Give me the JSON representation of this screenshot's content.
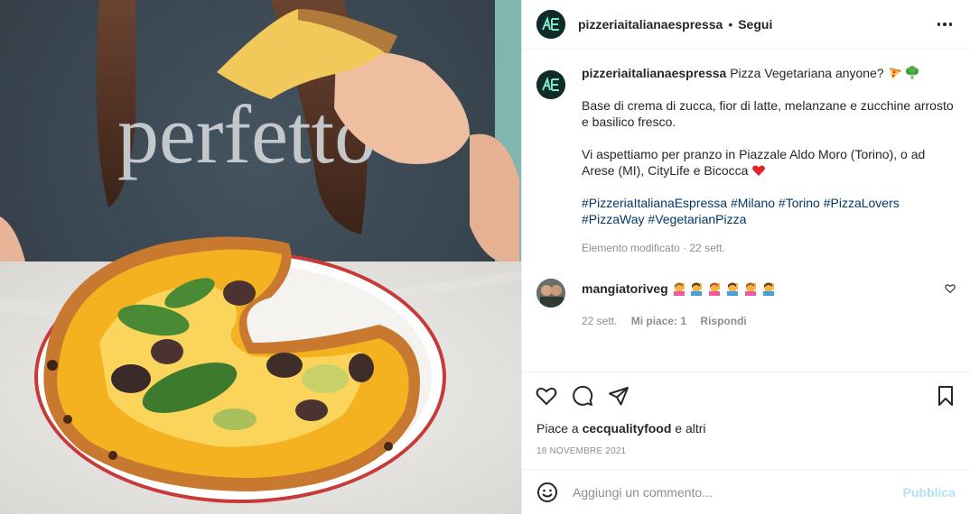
{
  "post": {
    "username": "pizzeriaitalianaespressa",
    "dot": "•",
    "follow_label": "Segui",
    "image_shirt_text": "perfetto",
    "caption": {
      "username": "pizzeriaitalianaespressa",
      "title": "Pizza Vegetariana anyone?",
      "line1": "Base di crema di zucca, fior di latte, melanzane e zucchine arrosto e basilico fresco.",
      "line2": "Vi aspettiamo per pranzo in Piazzale Aldo Moro (Torino), o ad Arese (MI), CityLife e Bicocca",
      "hashtags": [
        "#PizzeriaItalianaEspressa",
        "#Milano",
        "#Torino",
        "#PizzaLovers",
        "#PizzaWay",
        "#VegetarianPizza"
      ],
      "meta": "Elemento modificato · 22 sett."
    },
    "comment": {
      "username": "mangiatoriveg",
      "time": "22 sett.",
      "likes": "Mi piace: 1",
      "reply": "Rispondi"
    },
    "likes_prefix": "Piace a ",
    "likes_user": "cecqualityfood",
    "likes_suffix": " e altri",
    "date": "18 NOVEMBRE 2021",
    "add_comment_placeholder": "Aggiungi un commento...",
    "publish_label": "Pubblica"
  },
  "colors": {
    "link": "#00376b",
    "muted": "#8e8e8e",
    "publish_disabled": "#b2dffc",
    "heart": "#ed4956"
  },
  "icons": [
    "more-icon",
    "heart-icon",
    "comment-icon",
    "share-icon",
    "save-icon",
    "smile-icon",
    "pizza-emoji",
    "broccoli-emoji",
    "red-heart-emoji",
    "raising-hand-emoji"
  ]
}
